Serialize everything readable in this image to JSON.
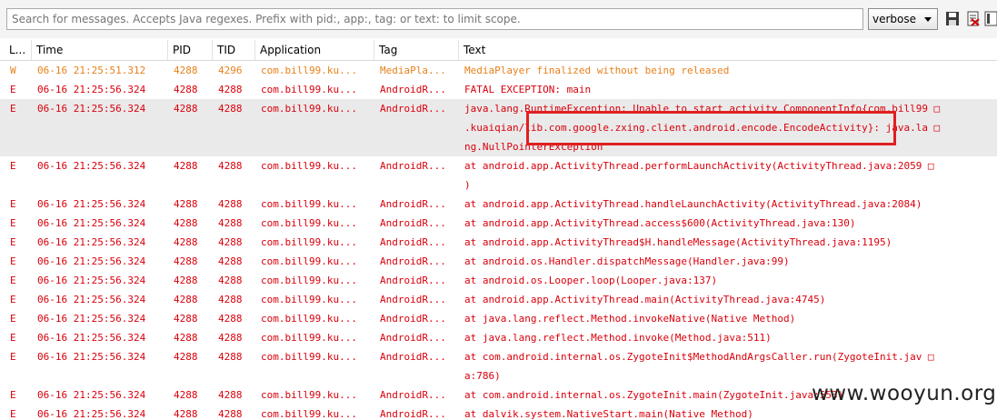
{
  "search": {
    "placeholder": "Search for messages. Accepts Java regexes. Prefix with pid:, app:, tag: or text: to limit scope.",
    "value": ""
  },
  "log_level": {
    "selected": "verbose"
  },
  "toolbar_icons": [
    "save-icon",
    "clear-log-icon",
    "scroll-lock-icon"
  ],
  "columns": {
    "level": "L...",
    "time": "Time",
    "pid": "PID",
    "tid": "TID",
    "application": "Application",
    "tag": "Tag",
    "text": "Text"
  },
  "colors": {
    "warn": "#e8801a",
    "error": "#d9000c",
    "highlight_box": "#e02020",
    "selected_row": "#eaeaea"
  },
  "rows": [
    {
      "level": "W",
      "time": "06-16 21:25:51.312",
      "pid": "4288",
      "tid": "4296",
      "app": "com.bill99.ku...",
      "tag": "MediaPla...",
      "text": [
        "MediaPlayer finalized without being released"
      ]
    },
    {
      "level": "E",
      "time": "06-16 21:25:56.324",
      "pid": "4288",
      "tid": "4288",
      "app": "com.bill99.ku...",
      "tag": "AndroidR...",
      "text": [
        "FATAL EXCEPTION: main"
      ]
    },
    {
      "level": "E",
      "time": "06-16 21:25:56.324",
      "pid": "4288",
      "tid": "4288",
      "app": "com.bill99.ku...",
      "tag": "AndroidR...",
      "text": [
        "java.lang.RuntimeException: Unable to start activity ComponentInfo{com.bill99 □",
        ".kuaiqian/lib.com.google.zxing.client.android.encode.EncodeActivity}: java.la □",
        "ng.NullPointerException"
      ]
    },
    {
      "level": "E",
      "time": "06-16 21:25:56.324",
      "pid": "4288",
      "tid": "4288",
      "app": "com.bill99.ku...",
      "tag": "AndroidR...",
      "text": [
        "at android.app.ActivityThread.performLaunchActivity(ActivityThread.java:2059 □",
        ")"
      ]
    },
    {
      "level": "E",
      "time": "06-16 21:25:56.324",
      "pid": "4288",
      "tid": "4288",
      "app": "com.bill99.ku...",
      "tag": "AndroidR...",
      "text": [
        "at android.app.ActivityThread.handleLaunchActivity(ActivityThread.java:2084)"
      ]
    },
    {
      "level": "E",
      "time": "06-16 21:25:56.324",
      "pid": "4288",
      "tid": "4288",
      "app": "com.bill99.ku...",
      "tag": "AndroidR...",
      "text": [
        "at android.app.ActivityThread.access$600(ActivityThread.java:130)"
      ]
    },
    {
      "level": "E",
      "time": "06-16 21:25:56.324",
      "pid": "4288",
      "tid": "4288",
      "app": "com.bill99.ku...",
      "tag": "AndroidR...",
      "text": [
        "at android.app.ActivityThread$H.handleMessage(ActivityThread.java:1195)"
      ]
    },
    {
      "level": "E",
      "time": "06-16 21:25:56.324",
      "pid": "4288",
      "tid": "4288",
      "app": "com.bill99.ku...",
      "tag": "AndroidR...",
      "text": [
        "at android.os.Handler.dispatchMessage(Handler.java:99)"
      ]
    },
    {
      "level": "E",
      "time": "06-16 21:25:56.324",
      "pid": "4288",
      "tid": "4288",
      "app": "com.bill99.ku...",
      "tag": "AndroidR...",
      "text": [
        "at android.os.Looper.loop(Looper.java:137)"
      ]
    },
    {
      "level": "E",
      "time": "06-16 21:25:56.324",
      "pid": "4288",
      "tid": "4288",
      "app": "com.bill99.ku...",
      "tag": "AndroidR...",
      "text": [
        "at android.app.ActivityThread.main(ActivityThread.java:4745)"
      ]
    },
    {
      "level": "E",
      "time": "06-16 21:25:56.324",
      "pid": "4288",
      "tid": "4288",
      "app": "com.bill99.ku...",
      "tag": "AndroidR...",
      "text": [
        "at java.lang.reflect.Method.invokeNative(Native Method)"
      ]
    },
    {
      "level": "E",
      "time": "06-16 21:25:56.324",
      "pid": "4288",
      "tid": "4288",
      "app": "com.bill99.ku...",
      "tag": "AndroidR...",
      "text": [
        "at java.lang.reflect.Method.invoke(Method.java:511)"
      ]
    },
    {
      "level": "E",
      "time": "06-16 21:25:56.324",
      "pid": "4288",
      "tid": "4288",
      "app": "com.bill99.ku...",
      "tag": "AndroidR...",
      "text": [
        "at com.android.internal.os.ZygoteInit$MethodAndArgsCaller.run(ZygoteInit.jav □",
        "a:786)"
      ]
    },
    {
      "level": "E",
      "time": "06-16 21:25:56.324",
      "pid": "4288",
      "tid": "4288",
      "app": "com.bill99.ku...",
      "tag": "AndroidR...",
      "text": [
        "at com.android.internal.os.ZygoteInit.main(ZygoteInit.java:553)"
      ]
    },
    {
      "level": "E",
      "time": "06-16 21:25:56.324",
      "pid": "4288",
      "tid": "4288",
      "app": "com.bill99.ku...",
      "tag": "AndroidR...",
      "text": [
        "at dalvik.system.NativeStart.main(Native Method)"
      ]
    }
  ],
  "selected_row_index": 2,
  "watermark": "www.wooyun.org"
}
